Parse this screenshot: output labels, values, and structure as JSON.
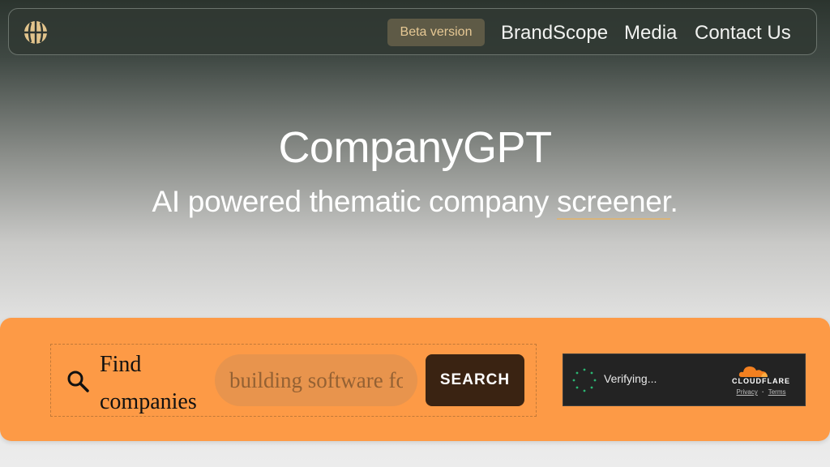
{
  "nav": {
    "logo_icon": "globe-icon",
    "beta_label": "Beta version",
    "links": [
      "BrandScope",
      "Media",
      "Contact Us"
    ]
  },
  "hero": {
    "title": "CompanyGPT",
    "subtitle_before": "AI powered thematic company ",
    "subtitle_highlight": "screener",
    "subtitle_after": "."
  },
  "search": {
    "icon": "search-icon",
    "label": "Find companies",
    "placeholder": "building software for",
    "button_label": "SEARCH"
  },
  "captcha": {
    "status": "Verifying...",
    "brand": "CLOUDFLARE",
    "privacy": "Privacy",
    "separator": "·",
    "terms": "Terms"
  },
  "colors": {
    "accent": "#fd9a46",
    "button": "#3a2312",
    "beta_bg": "#5e5a46",
    "beta_text": "#e6c894",
    "cloudflare_orange": "#f38020"
  }
}
